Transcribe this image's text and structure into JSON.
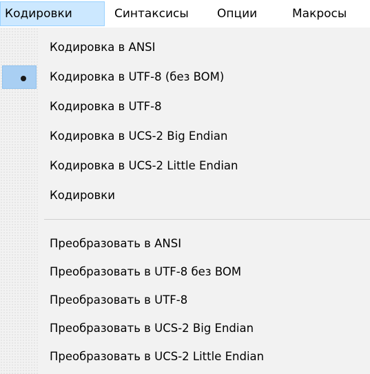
{
  "menubar": {
    "items": [
      {
        "label": "Кодировки",
        "active": true
      },
      {
        "label": "Синтаксисы"
      },
      {
        "label": "Опции"
      },
      {
        "label": "Макросы"
      }
    ]
  },
  "dropdown": {
    "encoding_items": [
      {
        "label": "Кодировка в ANSI"
      },
      {
        "label": "Кодировка в UTF-8 (без BOM)",
        "checked": true
      },
      {
        "label": "Кодировка в UTF-8"
      },
      {
        "label": "Кодировка в UCS-2 Big Endian"
      },
      {
        "label": "Кодировка в UCS-2 Little Endian"
      },
      {
        "label": "Кодировки"
      }
    ],
    "convert_items": [
      {
        "label": "Преобразовать в ANSI"
      },
      {
        "label": "Преобразовать в UTF-8 без BOM"
      },
      {
        "label": "Преобразовать в UTF-8"
      },
      {
        "label": "Преобразовать в UCS-2 Big Endian"
      },
      {
        "label": "Преобразовать в UCS-2 Little Endian"
      }
    ]
  },
  "colors": {
    "menubar_active_bg": "#cce8ff",
    "checked_item_bg": "#a9cff3",
    "menu_bg": "#f2f2f2"
  }
}
